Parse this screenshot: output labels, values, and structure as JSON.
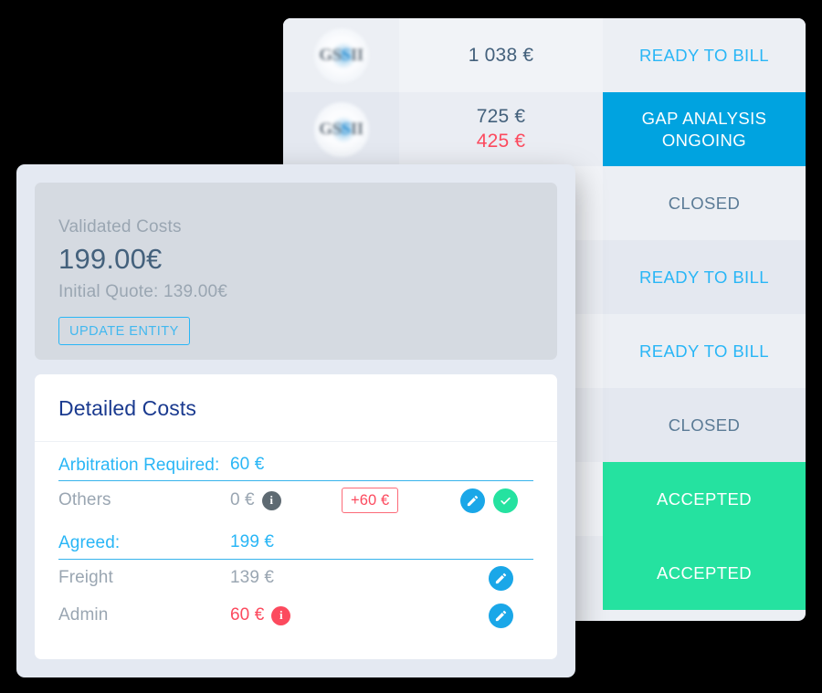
{
  "colors": {
    "page_background": "#000000",
    "accent_blue": "#29b6f6",
    "status_gap_blue": "#00a3e0",
    "status_accepted_green": "#25e2a0",
    "danger_red": "#fc4a5e",
    "title_navy": "#1a3a8f",
    "muted_grey": "#9aa6b2",
    "slate": "#5b7b96"
  },
  "status_table": {
    "rows": [
      {
        "logo": "gsi-company-logo",
        "amount": "1 038 €",
        "amount_secondary": "",
        "status": "READY TO BILL",
        "status_style": "ready",
        "banding": "norm"
      },
      {
        "logo": "gsi-company-logo",
        "amount": "725 €",
        "amount_secondary": "425 €",
        "status": "GAP ANALYSIS ONGOING",
        "status_style": "gap",
        "banding": "alt"
      },
      {
        "logo": "gsi-company-logo",
        "amount": "",
        "amount_secondary": "",
        "status": "CLOSED",
        "status_style": "closed",
        "banding": "norm"
      },
      {
        "logo": "gsi-company-logo",
        "amount": "",
        "amount_secondary": "",
        "status": "READY TO BILL",
        "status_style": "ready",
        "banding": "alt"
      },
      {
        "logo": "gsi-company-logo",
        "amount": "",
        "amount_secondary": "",
        "status": "READY TO BILL",
        "status_style": "ready",
        "banding": "norm"
      },
      {
        "logo": "gsi-company-logo",
        "amount": "",
        "amount_secondary": "",
        "status": "CLOSED",
        "status_style": "closed",
        "banding": "alt"
      },
      {
        "logo": "gsi-company-logo",
        "amount": "",
        "amount_secondary": "",
        "status": "ACCEPTED",
        "status_style": "accepted",
        "banding": "norm"
      },
      {
        "logo": "gsi-company-logo",
        "amount": "",
        "amount_secondary": "",
        "status": "ACCEPTED",
        "status_style": "accepted",
        "banding": "alt"
      }
    ]
  },
  "detail_card": {
    "validated": {
      "label": "Validated Costs",
      "value": "199.00€",
      "initial_quote": "Initial Quote: 139.00€",
      "update_button": "UPDATE ENTITY"
    },
    "costs": {
      "title": "Detailed Costs",
      "groups": [
        {
          "heading": "Arbitration Required:",
          "heading_value": "60 €",
          "rows": [
            {
              "label": "Others",
              "value": "0 €",
              "value_color": "muted",
              "info_badge": "i",
              "info_badge_color": "grey",
              "delta": "+60 €",
              "actions": [
                "edit-icon",
                "check-icon"
              ]
            }
          ]
        },
        {
          "heading": "Agreed:",
          "heading_value": "199 €",
          "rows": [
            {
              "label": "Freight",
              "value": "139 €",
              "value_color": "muted",
              "info_badge": "",
              "info_badge_color": "",
              "delta": "",
              "actions": [
                "edit-icon"
              ]
            },
            {
              "label": "Admin",
              "value": "60 €",
              "value_color": "red",
              "info_badge": "i",
              "info_badge_color": "red",
              "delta": "",
              "actions": [
                "edit-icon"
              ]
            }
          ]
        }
      ]
    }
  }
}
